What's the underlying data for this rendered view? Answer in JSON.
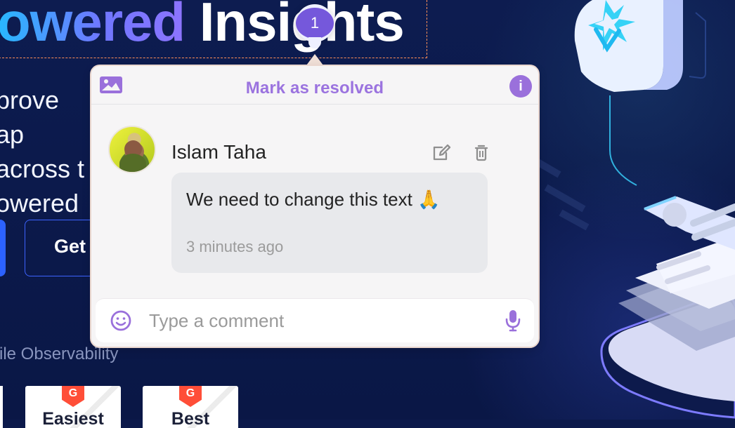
{
  "hero": {
    "title_accent": "owered",
    "title_plain": "Insights",
    "copy": "prove ap\nacross t\nowered",
    "cta": "Get",
    "observability": "ile Observability",
    "badges": [
      {
        "logo": "G",
        "label": "Easiest"
      },
      {
        "logo": "G",
        "label": "Best"
      }
    ]
  },
  "pin": {
    "number": "1"
  },
  "comment": {
    "header": {
      "image_icon": "image-icon",
      "resolve_label": "Mark as resolved",
      "info_icon": "info-icon"
    },
    "author": {
      "name": "Islam Taha",
      "avatar_icon": "user-avatar"
    },
    "actions": {
      "edit_icon": "edit-icon",
      "delete_icon": "trash-icon"
    },
    "message": {
      "text": "We need to change this text 🙏",
      "time": "3 minutes ago"
    },
    "composer": {
      "placeholder": "Type a comment",
      "emoji_icon": "emoji-icon",
      "mic_icon": "microphone-icon"
    }
  },
  "colors": {
    "background": "#0c1a4b",
    "accent": "#7558db",
    "resolve": "#9b73df",
    "panel": "#f6f5f6",
    "message_bg": "#e8e9ec"
  }
}
